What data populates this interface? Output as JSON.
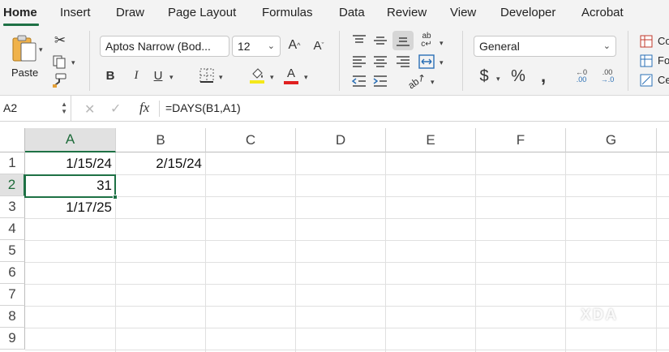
{
  "tabs": [
    "Home",
    "Insert",
    "Draw",
    "Page Layout",
    "Formulas",
    "Data",
    "Review",
    "View",
    "Developer",
    "Acrobat"
  ],
  "ribbon": {
    "paste_label": "Paste",
    "font_name": "Aptos Narrow (Bod...",
    "font_size": "12",
    "bold_label": "B",
    "italic_label": "I",
    "underline_label": "U",
    "number_format": "General",
    "styles": [
      "Co",
      "Fo",
      "Ce"
    ]
  },
  "formula_bar": {
    "name_box": "A2",
    "fx_label": "fx",
    "formula": "=DAYS(B1,A1)"
  },
  "sheet": {
    "columns": [
      "A",
      "B",
      "C",
      "D",
      "E",
      "F",
      "G"
    ],
    "rows": [
      "1",
      "2",
      "3",
      "4",
      "5",
      "6",
      "7",
      "8",
      "9"
    ],
    "cells": {
      "A1": "1/15/24",
      "B1": "2/15/24",
      "A2": "31",
      "A3": "1/17/25"
    },
    "selected_cell": "A2"
  },
  "watermark": "XDA",
  "colors": {
    "accent": "#1e7145",
    "highlight": "#f4e81a",
    "font_color": "#e02020"
  }
}
